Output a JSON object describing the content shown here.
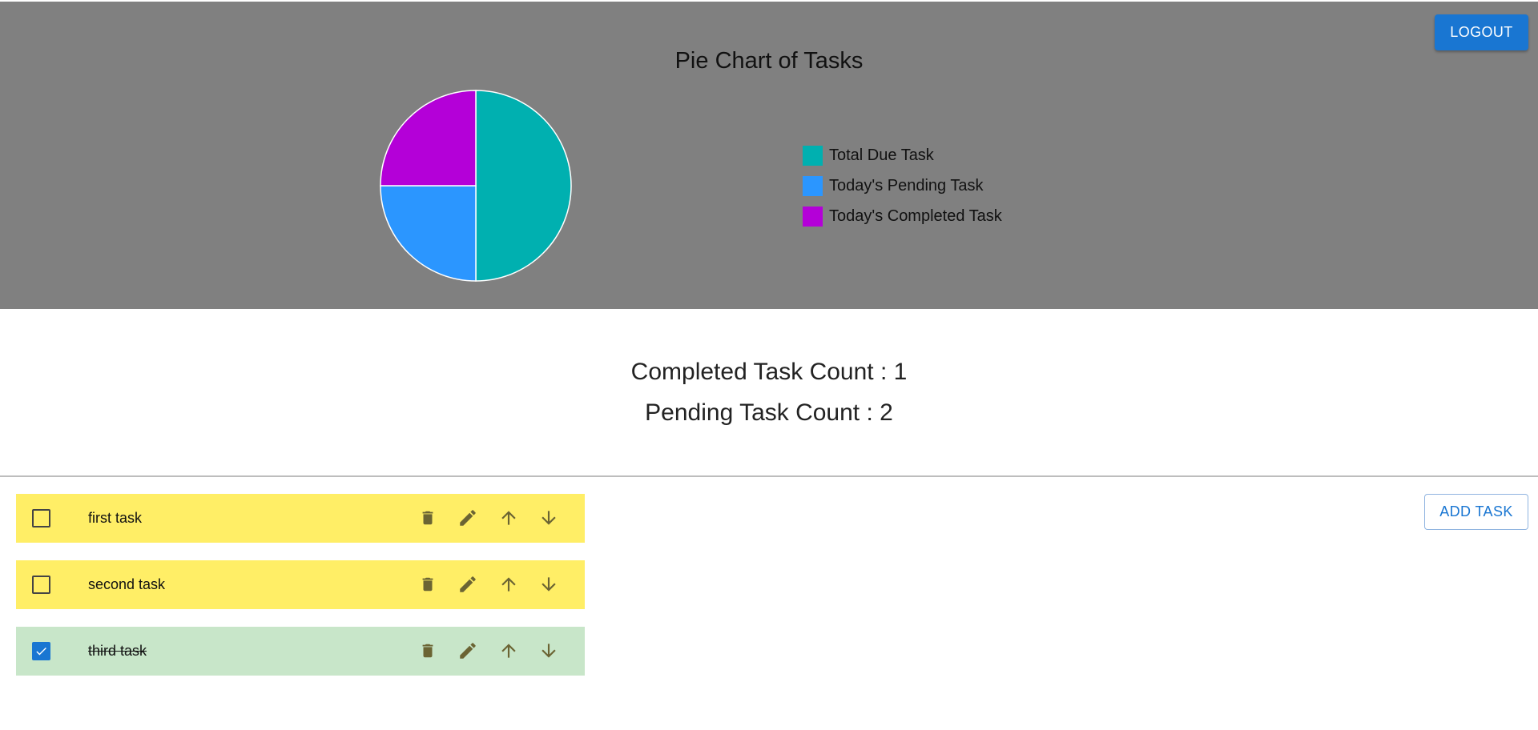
{
  "header": {
    "logout_label": "LOGOUT"
  },
  "chart_data": {
    "type": "pie",
    "title": "Pie Chart of Tasks",
    "categories": [
      "Total Due Task",
      "Today's Pending Task",
      "Today's Completed Task"
    ],
    "values": [
      2,
      1,
      1
    ],
    "colors": [
      "#00b0b0",
      "#2b96ff",
      "#b400d8"
    ],
    "legend_position": "right"
  },
  "counts": {
    "completed_text": "Completed Task Count : 1",
    "pending_text": "Pending Task Count : 2"
  },
  "actions": {
    "add_task_label": "ADD TASK"
  },
  "tasks": [
    {
      "label": "first task",
      "done": false
    },
    {
      "label": "second task",
      "done": false
    },
    {
      "label": "third task",
      "done": true
    }
  ],
  "icons": {
    "delete": "trash-icon",
    "edit": "pencil-icon",
    "up": "arrow-up-icon",
    "down": "arrow-down-icon",
    "check": "check-icon"
  },
  "colors": {
    "pending_row": "#ffee66",
    "done_row": "#c8e6c9",
    "accent": "#1976d2"
  }
}
